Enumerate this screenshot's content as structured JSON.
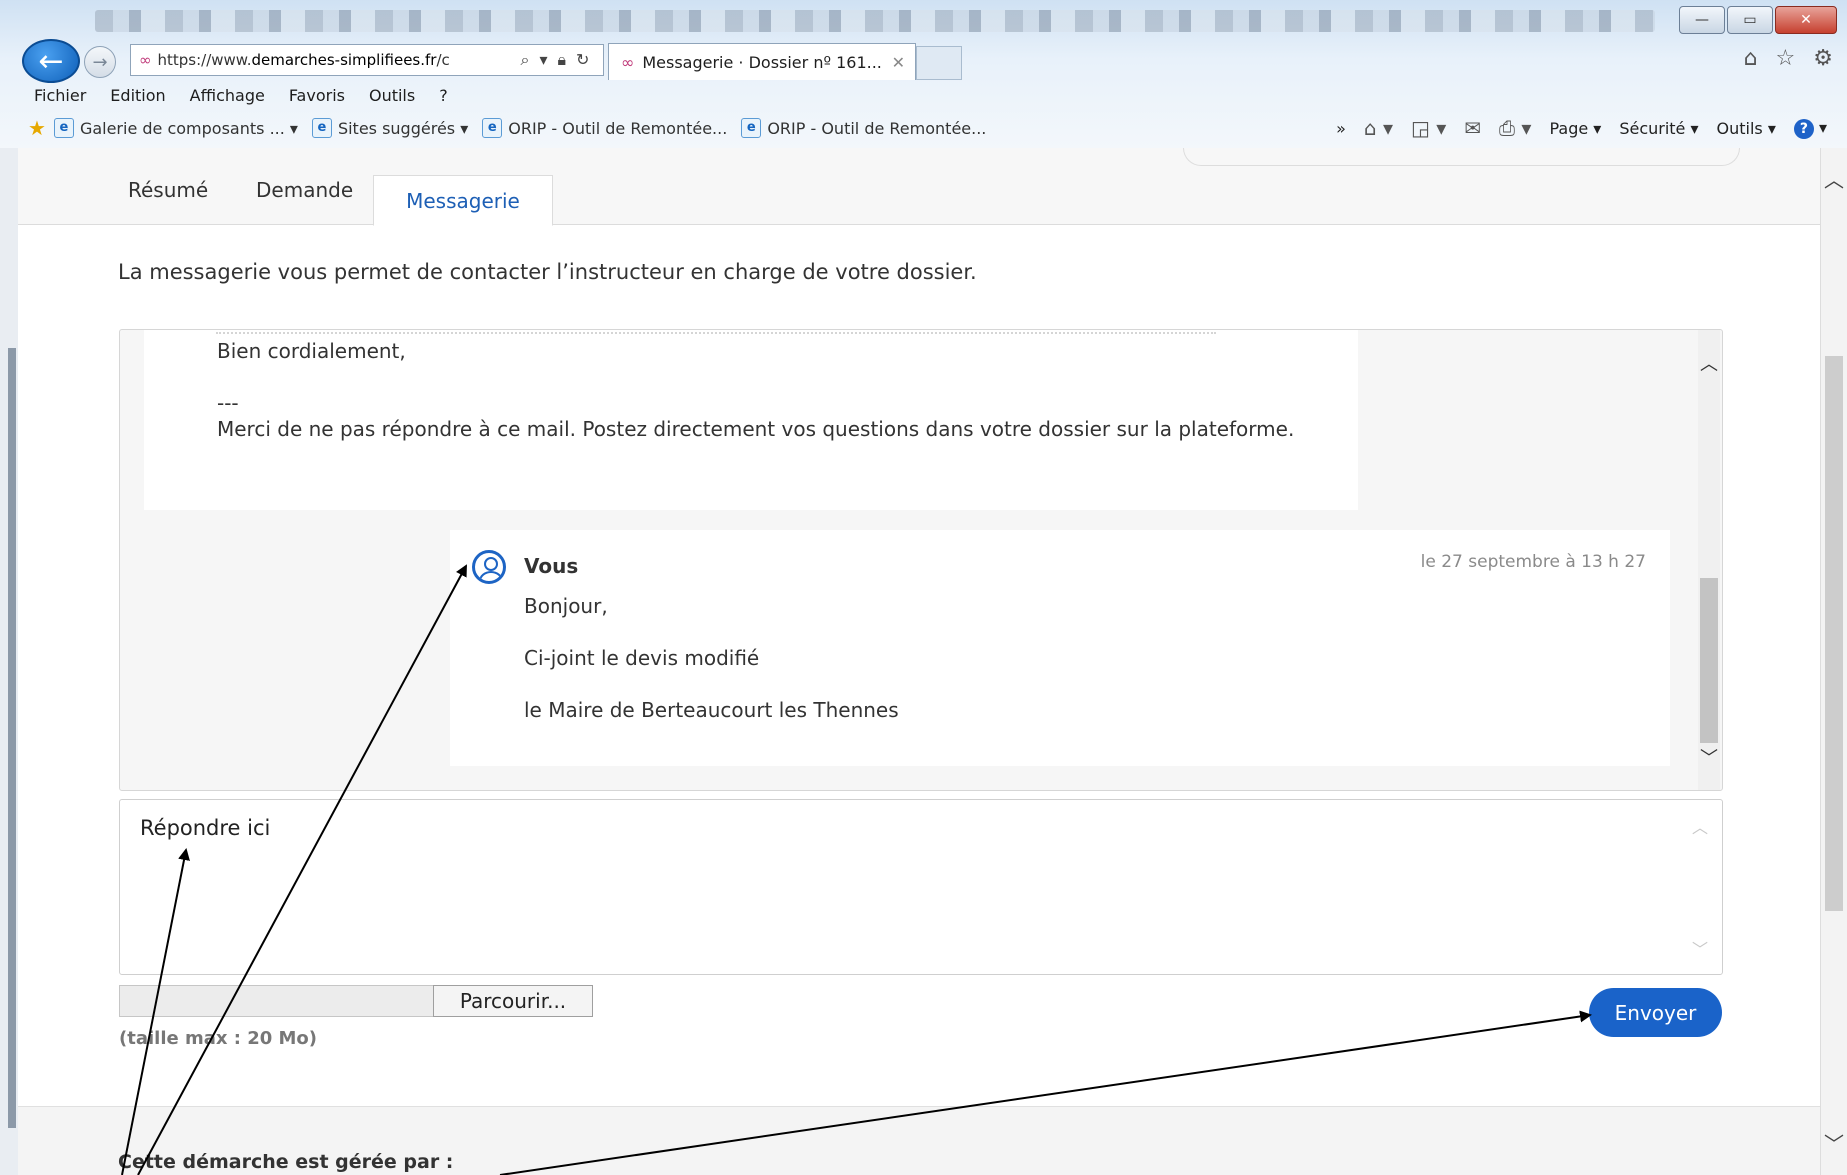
{
  "browser": {
    "url_prefix": "https://www.",
    "url_domain": "demarches-simplifiees.fr",
    "url_rest": "/c",
    "tab_title": "Messagerie · Dossier nº 161...",
    "tab_close": "✕",
    "menu": [
      "Fichier",
      "Edition",
      "Affichage",
      "Favoris",
      "Outils",
      "?"
    ],
    "favorites": [
      "Galerie de composants ... ▾",
      "Sites suggérés ▾",
      "ORIP - Outil de Remontée...",
      "ORIP - Outil de Remontée..."
    ],
    "commands": {
      "more": "»",
      "page": "Page ▾",
      "security": "Sécurité ▾",
      "tools": "Outils ▾"
    },
    "window_buttons": {
      "minimize": "—",
      "maximize": "▭",
      "close": "✕"
    }
  },
  "tabs": [
    {
      "label": "Résumé"
    },
    {
      "label": "Demande"
    },
    {
      "label": "Messagerie"
    }
  ],
  "intro": "La messagerie vous permet de contacter l’instructeur en charge de votre dossier.",
  "previous_message": {
    "closing": "Bien cordialement,",
    "separator": "---",
    "notice": "Merci de ne pas répondre à ce mail. Postez directement vos questions dans votre dossier sur la plateforme."
  },
  "my_message": {
    "sender": "Vous",
    "date": "le 27 septembre à 13 h 27",
    "lines": [
      "Bonjour,",
      "Ci-joint le devis modifié",
      "le Maire de Berteaucourt les Thennes"
    ]
  },
  "reply": {
    "placeholder": "Répondre ici",
    "browse_label": "Parcourir...",
    "size_hint": "(taille max : 20 Mo)",
    "send_label": "Envoyer"
  },
  "footer": {
    "managed_by": "Cette démarche est gérée par :"
  },
  "colors": {
    "accent": "#1a63c9",
    "annotation": "#000000"
  }
}
